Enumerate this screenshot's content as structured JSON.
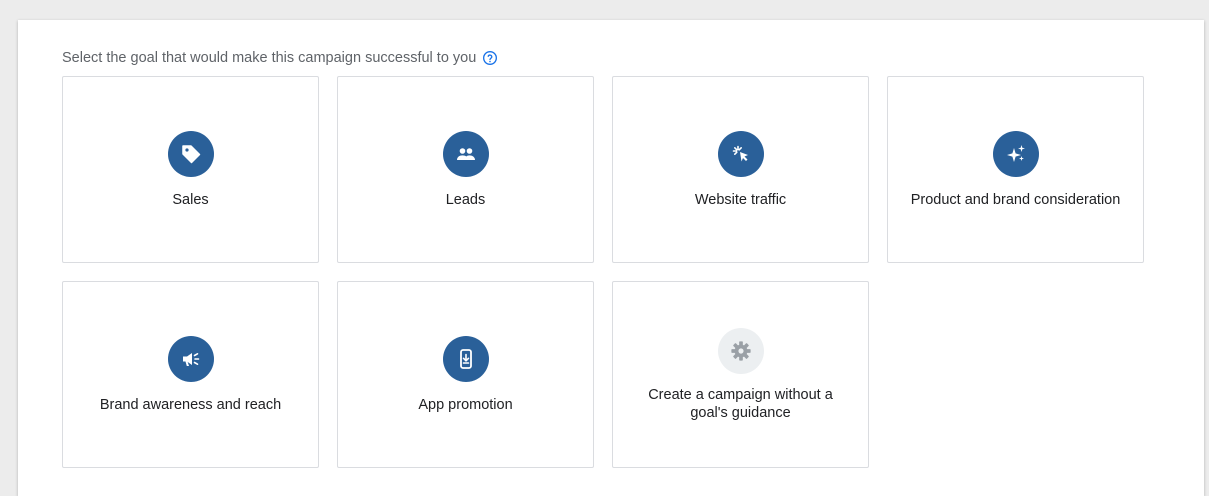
{
  "prompt": {
    "text": "Select the goal that would make this campaign successful to you",
    "help_icon": "help-circle-icon"
  },
  "colors": {
    "icon_bg": "#2a6099",
    "icon_bg_disabled": "#eceff1",
    "card_border": "#dadce0",
    "prompt_text": "#5f6368"
  },
  "goals": [
    {
      "label": "Sales",
      "icon": "tag-icon"
    },
    {
      "label": "Leads",
      "icon": "people-icon"
    },
    {
      "label": "Website traffic",
      "icon": "cursor-click-icon"
    },
    {
      "label": "Product and brand consideration",
      "icon": "sparkle-icon"
    },
    {
      "label": "Brand awareness and reach",
      "icon": "megaphone-icon"
    },
    {
      "label": "App promotion",
      "icon": "phone-download-icon"
    },
    {
      "label": "Create a campaign without a goal's guidance",
      "icon": "gear-icon"
    }
  ]
}
